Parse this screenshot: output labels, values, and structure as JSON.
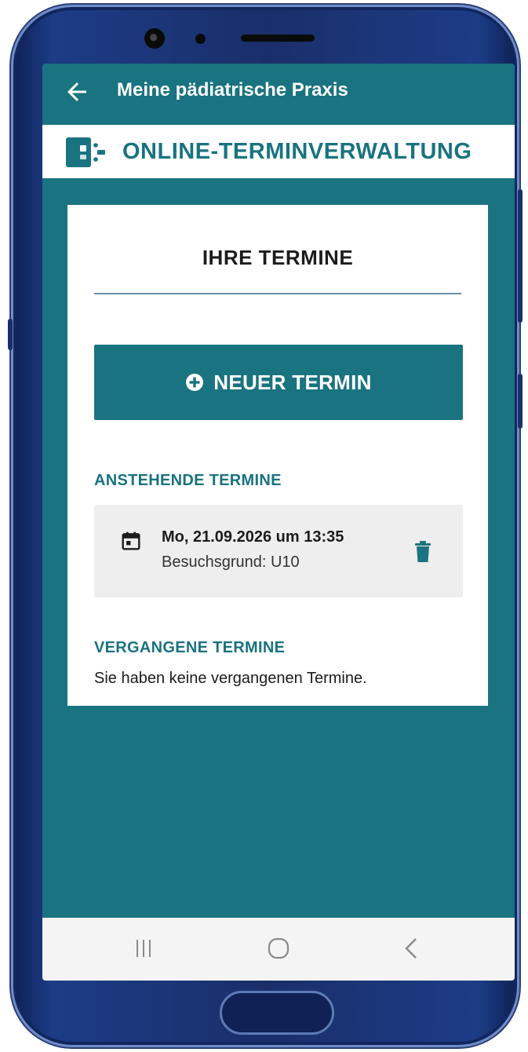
{
  "appbar": {
    "title": "Meine pädiatrische Praxis",
    "back_icon": "arrow-left-icon"
  },
  "brand": {
    "title": "ONLINE-TERMINVERWALTUNG",
    "logo_icon": "door-exit-icon"
  },
  "card": {
    "title": "IHRE TERMINE",
    "new_button": {
      "label": "NEUER TERMIN",
      "icon": "plus-circle-icon"
    },
    "upcoming": {
      "heading": "ANSTEHENDE TERMINE",
      "items": [
        {
          "date": "Mo, 21.09.2026 um 13:35",
          "reason": "Besuchsgrund: U10",
          "icon": "calendar-icon",
          "action_icon": "trash-icon"
        }
      ]
    },
    "past": {
      "heading": "VERGANGENE TERMINE",
      "empty_text": "Sie haben keine vergangenen Termine."
    }
  },
  "navbar": {
    "recents_icon": "recents-icon",
    "home_icon": "home-icon",
    "back_icon": "back-chevron-icon"
  },
  "colors": {
    "primary": "#1a7380",
    "card": "#ffffff",
    "appt_bg": "#eeeeee",
    "text": "#1c1c1c"
  }
}
